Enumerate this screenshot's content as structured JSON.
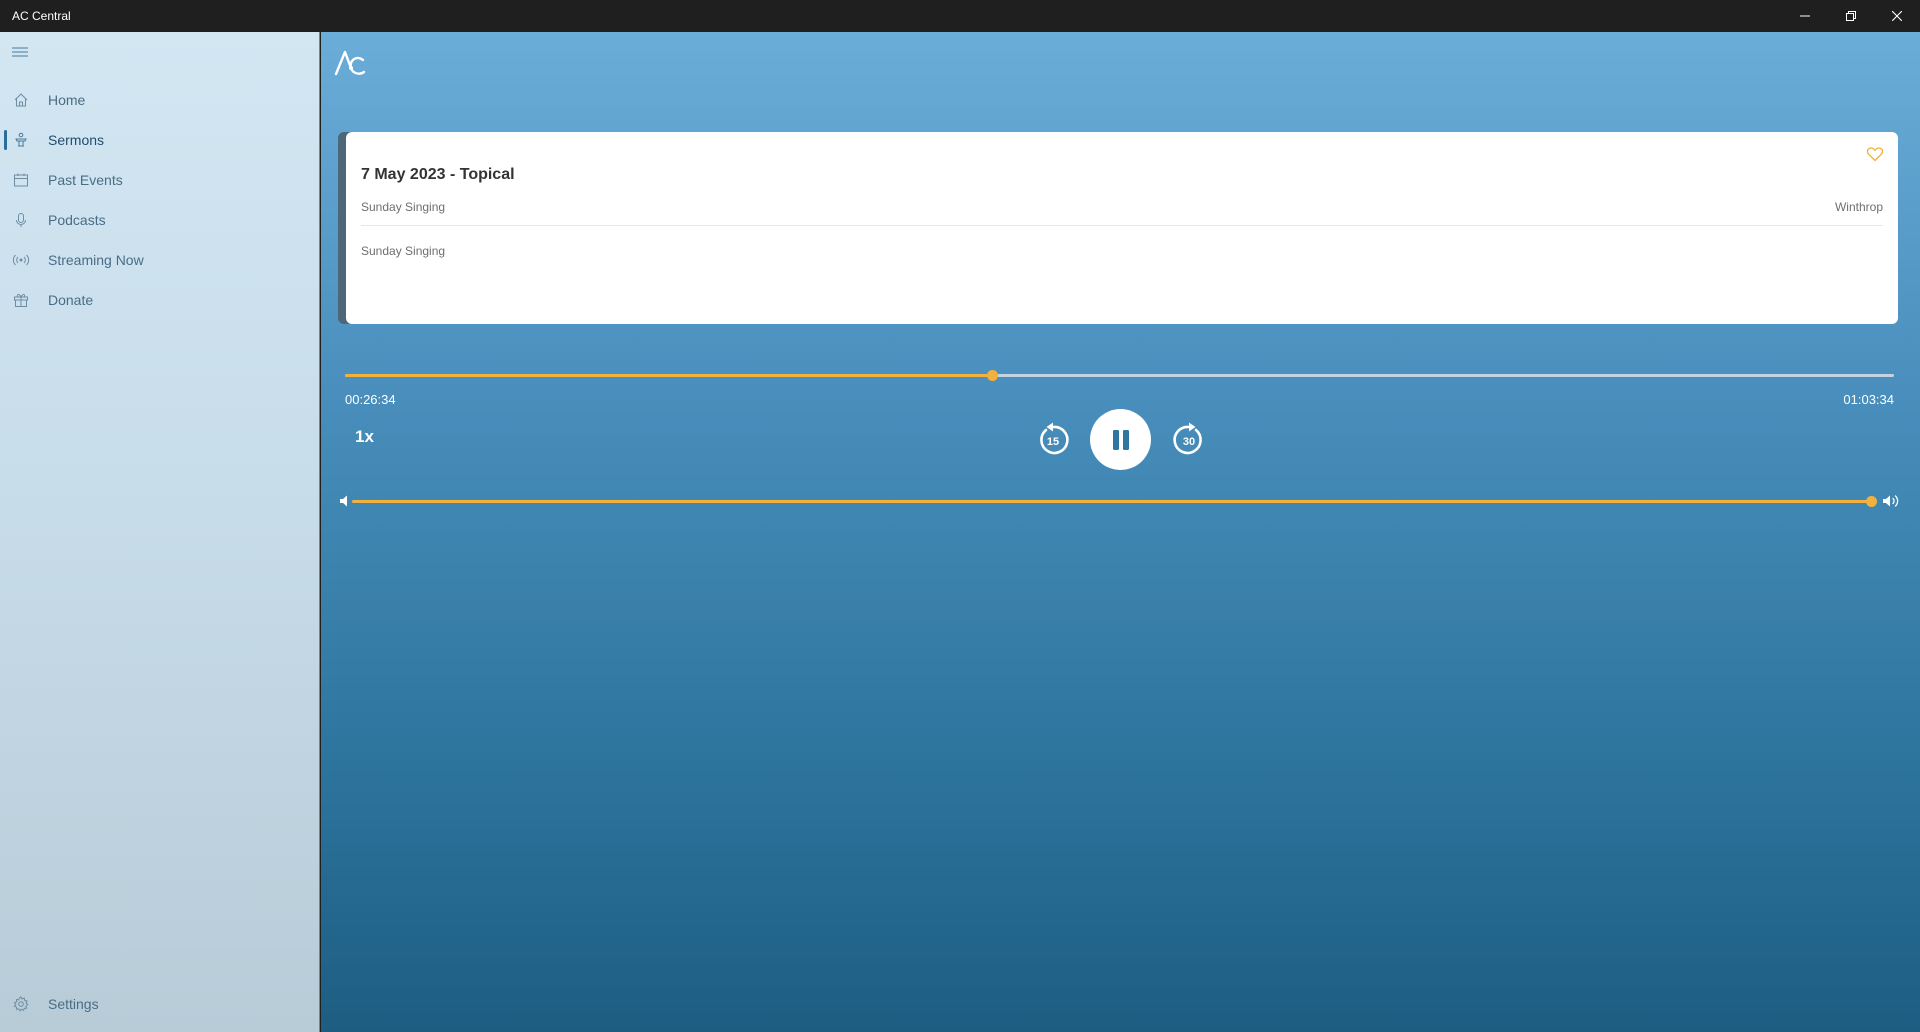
{
  "window": {
    "title": "AC Central"
  },
  "sidebar": {
    "items": [
      {
        "label": "Home",
        "icon": "home-icon"
      },
      {
        "label": "Sermons",
        "icon": "podium-icon",
        "active": true
      },
      {
        "label": "Past Events",
        "icon": "calendar-icon"
      },
      {
        "label": "Podcasts",
        "icon": "microphone-icon"
      },
      {
        "label": "Streaming Now",
        "icon": "broadcast-icon"
      },
      {
        "label": "Donate",
        "icon": "gift-icon"
      }
    ],
    "settings_label": "Settings"
  },
  "sermon": {
    "title": "7 May 2023 - Topical",
    "subtitle": "Sunday Singing",
    "location": "Winthrop",
    "description": "Sunday Singing",
    "favorite": false
  },
  "player": {
    "current_time": "00:26:34",
    "total_time": "01:03:34",
    "progress_fraction": 0.418,
    "speed": "1x",
    "rewind_seconds": "15",
    "forward_seconds": "30",
    "state": "playing",
    "volume_fraction": 1.0
  },
  "colors": {
    "accent": "#f2b13c",
    "sidebar_bg": "#c7dde9",
    "main_top": "#6badd9",
    "main_bottom": "#1d5d82",
    "titlebar": "#1f1f1f"
  }
}
